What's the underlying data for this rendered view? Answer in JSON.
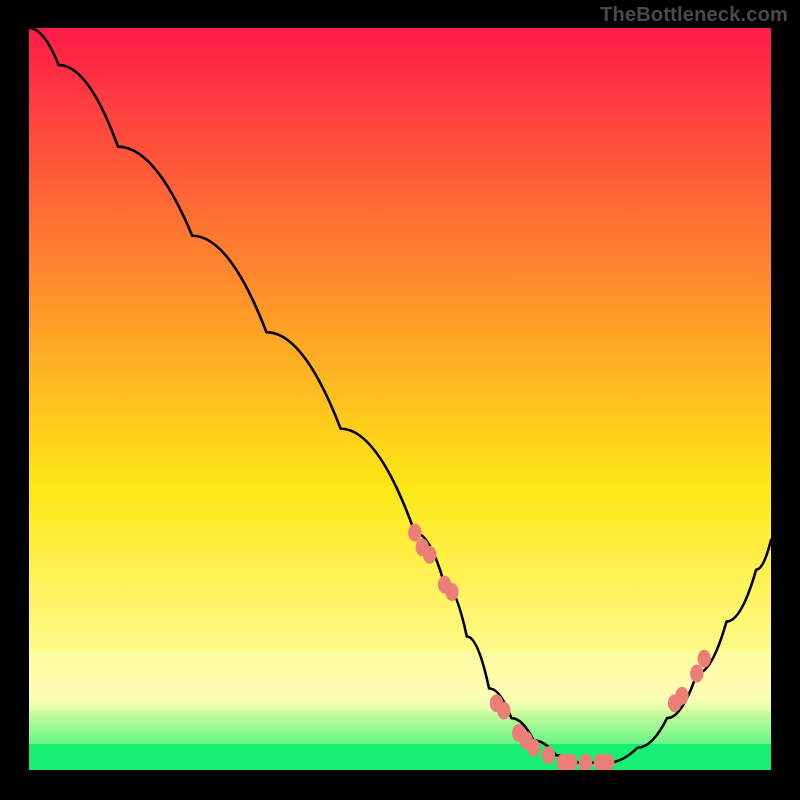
{
  "watermark": "TheBottleneck.com",
  "colors": {
    "gradient_top": "#fe1b48",
    "gradient_mid": "#fee815",
    "gradient_pale": "#feffaa",
    "gradient_bottom": "#17ef73",
    "curve": "#000000",
    "markers": "#eb7f77",
    "background": "#000000"
  },
  "chart_data": {
    "type": "line",
    "title": "",
    "xlabel": "",
    "ylabel": "",
    "xlim": [
      0,
      100
    ],
    "ylim": [
      0,
      100
    ],
    "note": "No axis ticks or labels are rendered in the image; x/y values below are normalized to the plotted area (0–100).",
    "series": [
      {
        "name": "bottleneck-curve",
        "x": [
          0,
          4,
          12,
          22,
          32,
          42,
          52,
          56,
          59,
          62,
          65,
          68,
          71,
          74,
          78,
          82,
          86,
          90,
          94,
          98,
          100
        ],
        "y": [
          100,
          95,
          84,
          72,
          59,
          46,
          32,
          25,
          18,
          11,
          7,
          4,
          2,
          1,
          1,
          3,
          7,
          13,
          20,
          27,
          31
        ]
      }
    ],
    "markers": {
      "name": "highlighted-points",
      "x": [
        52,
        53,
        54,
        56,
        57,
        63,
        64,
        66,
        67,
        68,
        70,
        72,
        73,
        75,
        77,
        78,
        87,
        88,
        90,
        91
      ],
      "y": [
        32,
        30,
        29,
        25,
        24,
        9,
        8,
        5,
        4,
        3,
        2,
        1,
        1,
        1,
        1,
        1,
        9,
        10,
        13,
        15
      ]
    }
  }
}
